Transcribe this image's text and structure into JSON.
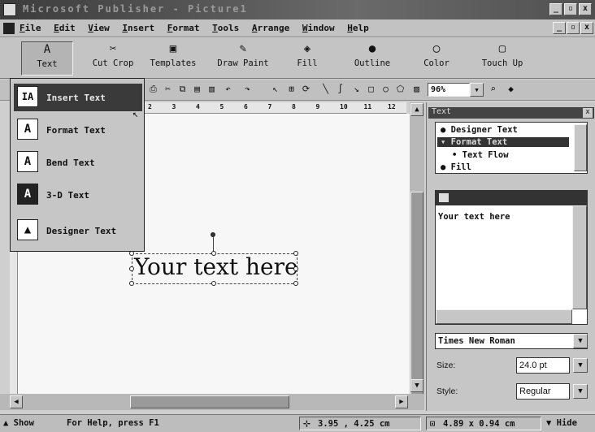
{
  "titlebar": {
    "title": "Microsoft Publisher - Picture1",
    "minimize": "_",
    "maximize": "▫",
    "close": "x"
  },
  "menubar": {
    "items": [
      "File",
      "Edit",
      "View",
      "Insert",
      "Format",
      "Tools",
      "Arrange",
      "Window",
      "Help"
    ],
    "doc_minimize": "_",
    "doc_restore": "▫",
    "doc_close": "x"
  },
  "big_toolbar": {
    "tools": [
      {
        "label": "Text",
        "icon": "A"
      },
      {
        "label": "Cut Crop",
        "icon": "✂"
      },
      {
        "label": "Templates",
        "icon": "▣"
      },
      {
        "label": "Draw Paint",
        "icon": "✎"
      },
      {
        "label": "Fill",
        "icon": "◈"
      },
      {
        "label": "Outline",
        "icon": "●"
      },
      {
        "label": "Color",
        "icon": "◯"
      },
      {
        "label": "Touch Up",
        "icon": "▢"
      }
    ]
  },
  "small_toolbar": {
    "zoom": "96%"
  },
  "ruler": {
    "ticks": [
      "2",
      "3",
      "4",
      "5",
      "6",
      "7",
      "8",
      "9",
      "10",
      "11",
      "12"
    ]
  },
  "flyout": {
    "items": [
      {
        "label": "Insert Text",
        "icon": "IA"
      },
      {
        "label": "Format Text",
        "icon": "A"
      },
      {
        "label": "Bend Text",
        "icon": "A"
      },
      {
        "label": "3-D Text",
        "icon": "A"
      },
      {
        "label": "Designer Text",
        "icon": "▲"
      }
    ]
  },
  "canvas": {
    "text_object": "Your text here"
  },
  "panel": {
    "title": "Text",
    "tree": [
      "Designer Text",
      "Format Text",
      "Text Flow",
      "Fill"
    ],
    "preview_text": "Your text here",
    "font": "Times New Roman",
    "size_label": "Size:",
    "size_value": "24.0 pt",
    "style_label": "Style:",
    "style_value": "Regular"
  },
  "status": {
    "show": "Show",
    "help": "For Help, press F1",
    "position": "3.95 , 4.25 cm",
    "size": "4.89 x 0.94 cm",
    "hide": "Hide"
  }
}
